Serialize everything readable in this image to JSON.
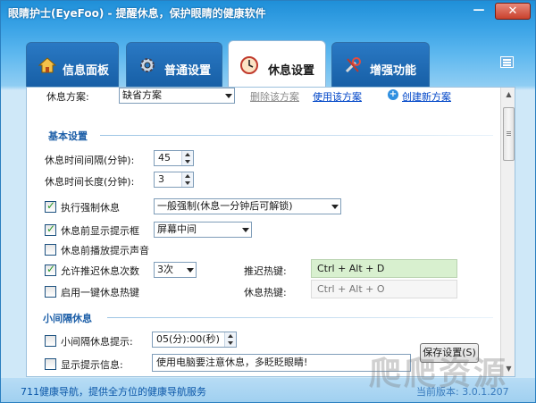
{
  "window": {
    "title": "眼睛护士(EyeFoo) - 提醒休息，保护眼睛的健康软件",
    "minimize_symbol": "—",
    "close_symbol": "✕"
  },
  "tabs": [
    {
      "label": "信息面板",
      "icon": "house-icon",
      "active": false
    },
    {
      "label": "普通设置",
      "icon": "gear-icon",
      "active": false
    },
    {
      "label": "休息设置",
      "icon": "clock-icon",
      "active": true
    },
    {
      "label": "增强功能",
      "icon": "tools-icon",
      "active": false
    }
  ],
  "scheme": {
    "label": "休息方案:",
    "selected": "缺省方案",
    "delete_label": "删除该方案",
    "use_label": "使用该方案",
    "create_label": "创建新方案"
  },
  "basic": {
    "section_title": "基本设置",
    "interval_label": "休息时间间隔(分钟):",
    "interval_value": "45",
    "duration_label": "休息时间长度(分钟):",
    "duration_value": "3",
    "force_label": "执行强制休息",
    "force_checked": true,
    "force_mode": "一般强制(休息一分钟后可解锁)",
    "prompt_label": "休息前显示提示框",
    "prompt_checked": true,
    "prompt_position": "屏幕中间",
    "sound_label": "休息前播放提示声音",
    "sound_checked": false,
    "postpone_label": "允许推迟休息次数",
    "postpone_checked": true,
    "postpone_count": "3次",
    "postpone_hotkey_label": "推迟热键:",
    "postpone_hotkey": "Ctrl + Alt + D",
    "onekey_label": "启用一键休息热键",
    "onekey_checked": false,
    "rest_hotkey_label": "休息热键:",
    "rest_hotkey": "Ctrl + Alt + O"
  },
  "mini": {
    "section_title": "小间隔休息",
    "reminder_label": "小间隔休息提示:",
    "reminder_checked": false,
    "reminder_value": "05(分):00(秒)",
    "show_info_label": "显示提示信息:",
    "show_info_checked": false,
    "info_text": "使用电脑要注意休息，多眨眨眼睛!",
    "save_label": "保存设置(S)"
  },
  "status": {
    "text": "711健康导航，提供全方位的健康导航服务",
    "right_text": "当前版本: 3.0.1.207"
  },
  "watermark": "爬爬资源"
}
